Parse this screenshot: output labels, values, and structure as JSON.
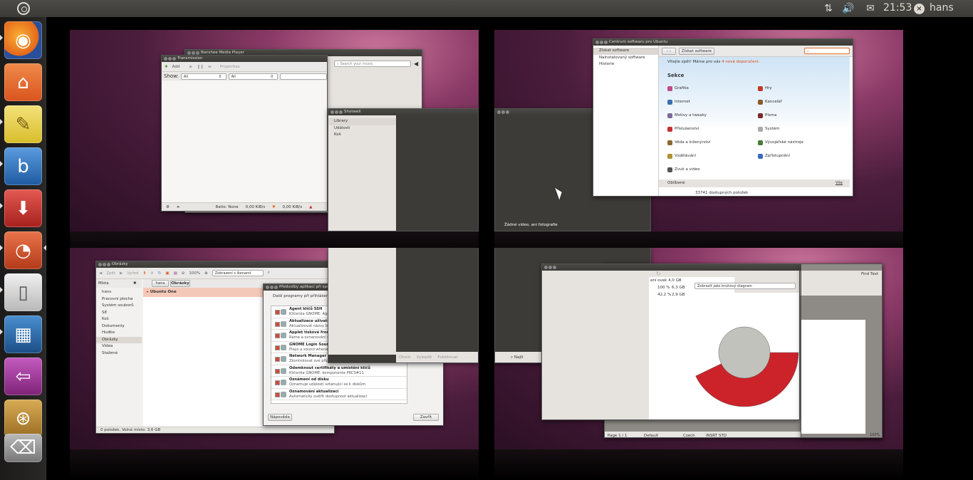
{
  "panel": {
    "clock": "21:53",
    "user": "hans",
    "icons": [
      "ubuntu-logo-icon",
      "network-icon",
      "volume-icon",
      "mail-icon",
      "session-icon"
    ]
  },
  "launcher": {
    "items": [
      {
        "name": "firefox",
        "icon": "firefox-icon",
        "color": "#e5671b"
      },
      {
        "name": "home-folder",
        "icon": "folder-home-icon",
        "color": "#e2662d"
      },
      {
        "name": "text-editor",
        "icon": "notepad-icon",
        "color": "#e8d34a"
      },
      {
        "name": "banshee",
        "icon": "banshee-icon",
        "color": "#2f6fb6"
      },
      {
        "name": "transmission",
        "icon": "transmission-icon",
        "color": "#c9302c"
      },
      {
        "name": "office-chart",
        "icon": "pie-chart-icon",
        "color": "#d64b2a"
      },
      {
        "name": "libreoffice",
        "icon": "document-icon",
        "color": "#cfcfcf"
      },
      {
        "name": "shotwell",
        "icon": "photos-icon",
        "color": "#2a6fa8"
      },
      {
        "name": "workspaces",
        "icon": "workspace-switcher-icon",
        "color": "#a4389a"
      },
      {
        "name": "software-center",
        "icon": "software-center-icon",
        "color": "#cc9a3a"
      }
    ]
  },
  "ws1": {
    "banshee_title": "Banshee Media Player",
    "transmission": {
      "title": "Transmission",
      "add": "Add",
      "properties": "Properties",
      "show": "Show:",
      "filter1": "All",
      "filter1_count": "0",
      "filter2": "All",
      "filter2_count": "0",
      "ratio": "Ratio: None",
      "down": "0,00 KiB/s",
      "up": "0,00 KiB/s"
    },
    "search_music": "Search your music",
    "shotwell": {
      "title": "Shotwell",
      "items": [
        "Library",
        "Události",
        "Koš"
      ]
    }
  },
  "ws2": {
    "empty_text": "Žádné video, ani fotografie",
    "software": {
      "title": "Centrum softwaru pro Ubuntu",
      "nav": [
        "Získat software",
        "Nainstalovaný software",
        "Historie"
      ],
      "breadcrumb": "Získat software",
      "welcome": "Vítejte zpět! Máme pro vás",
      "recommend": "4 nová doporučení.",
      "section": "Sekce",
      "left_cats": [
        "Grafika",
        "Internet",
        "Motivy a tweaky",
        "Příslušenství",
        "Věda a inženýrství",
        "Vzdělávání",
        "Zvuk a video"
      ],
      "right_cats": [
        "Hry",
        "Kancelář",
        "Písma",
        "Systém",
        "Vývojářské nástroje",
        "Zpřístupnění"
      ],
      "favorites": "Oblíbené",
      "all": "Vše",
      "count": "33741 dostupných položek"
    }
  },
  "ws3": {
    "nautilus": {
      "title": "Obrázky",
      "back": "Zpět",
      "forward": "Vpřed",
      "zoom": "100%",
      "view": "Zobrazení s ikonami",
      "places_label": "Místa",
      "crumb_home": "hans",
      "crumb_current": "Obrázky",
      "places": [
        "hans",
        "Pracovní plocha",
        "Systém souborů",
        "Síť",
        "Koš",
        "Dokumenty",
        "Hudba",
        "Obrázky",
        "Videa",
        "Stažené"
      ],
      "ubuntu_one": "Ubuntu One",
      "status": "0 položek, Volné místo: 3,6 GB"
    },
    "startup": {
      "title": "Předvolby aplikací při spuštění",
      "header": "Další programy při přihlášení:",
      "rows": [
        {
          "t": "Agent klíčů SSH",
          "d": "Klíčenka GNOME: Agent SSH"
        },
        {
          "t": "Aktualizace uživatelských složek",
          "d": "Aktualizovat názvy běžných složek"
        },
        {
          "t": "Applet tiskové fronty",
          "d": "Rame a ovnanování úloh tisku"
        },
        {
          "t": "GNOME Login Sound",
          "d": "Plays a sound whenever you log in"
        },
        {
          "t": "Network Manager",
          "d": "Zkontrolovat své připojení k síti"
        },
        {
          "t": "Odemknout certifikáty a umístění klíčů",
          "d": "Klíčenka GNOME: komponenta PKCS#11"
        },
        {
          "t": "Oznámení od disku",
          "d": "Oznamuje události vztahující se k diskům"
        },
        {
          "t": "Oznamování aktualizací",
          "d": "Automaticky ověřit dostupnost aktualizací"
        }
      ],
      "help": "Nápověda",
      "close": "Zavřít"
    },
    "shotwell_bar": [
      "Otočit",
      "Vylepšit",
      "Publikovat"
    ]
  },
  "ws4": {
    "find": "Najít",
    "disk": {
      "view_label": "Zobrazit jako kruhový diagram",
      "rows": [
        {
          "pct": "100 %",
          "size": "6,3 GB"
        },
        {
          "pct": "42,2 %",
          "size": "2,9 GB"
        }
      ],
      "header": "ení ovek 4,0 GB"
    },
    "writer": {
      "find_text": "Find Text",
      "page": "Page 1 / 1",
      "style": "Default",
      "lang": "Czech",
      "insert": "INSRT",
      "std": "STD",
      "zoom": "100%"
    },
    "chart_colors": {
      "used": "#cc2229",
      "free": "#c2c2bd"
    }
  }
}
